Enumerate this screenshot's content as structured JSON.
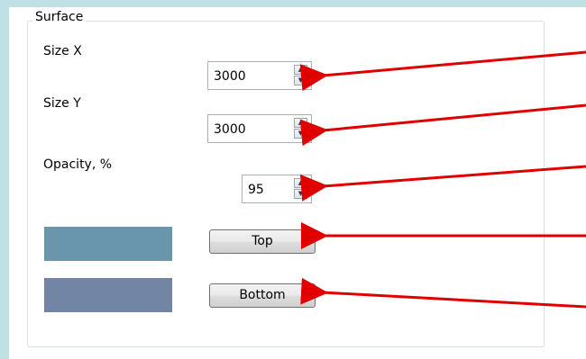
{
  "group": {
    "title": "Surface"
  },
  "fields": {
    "size_x": {
      "label": "Size X",
      "value": "3000"
    },
    "size_y": {
      "label": "Size Y",
      "value": "3000"
    },
    "opacity": {
      "label": "Opacity, %",
      "value": "95"
    }
  },
  "colors": {
    "top_swatch": "#6996ad",
    "bottom_swatch": "#7385a5",
    "arrow": "#e00000",
    "background": "#bfe1e6"
  },
  "buttons": {
    "top": "Top",
    "bottom": "Bottom"
  },
  "icons": {
    "spin_up": "▲",
    "spin_down": "▼"
  }
}
